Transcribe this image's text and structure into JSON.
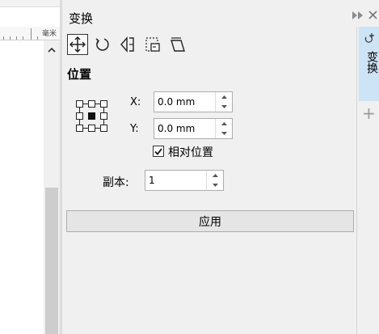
{
  "ruler": {
    "unit": "毫米"
  },
  "panel": {
    "title": "变换",
    "section_title": "位置",
    "x_label": "X:",
    "x_value": "0.0 mm",
    "y_label": "Y:",
    "y_value": "0.0 mm",
    "relative_label": "相对位置",
    "relative_checked": true,
    "copies_label": "副本:",
    "copies_value": "1",
    "apply_label": "应用"
  },
  "toolbar": {
    "tools": [
      "move-tool-icon",
      "rotate-tool-icon",
      "scale-mirror-tool-icon",
      "size-tool-icon",
      "skew-tool-icon"
    ],
    "active": "move-tool-icon"
  },
  "side_strip": {
    "tab_label": "变换"
  },
  "colors": {
    "panel_bg": "#f0f0f0",
    "active_tab": "#cde3f6",
    "scroll_thumb": "#cdcdcd"
  }
}
